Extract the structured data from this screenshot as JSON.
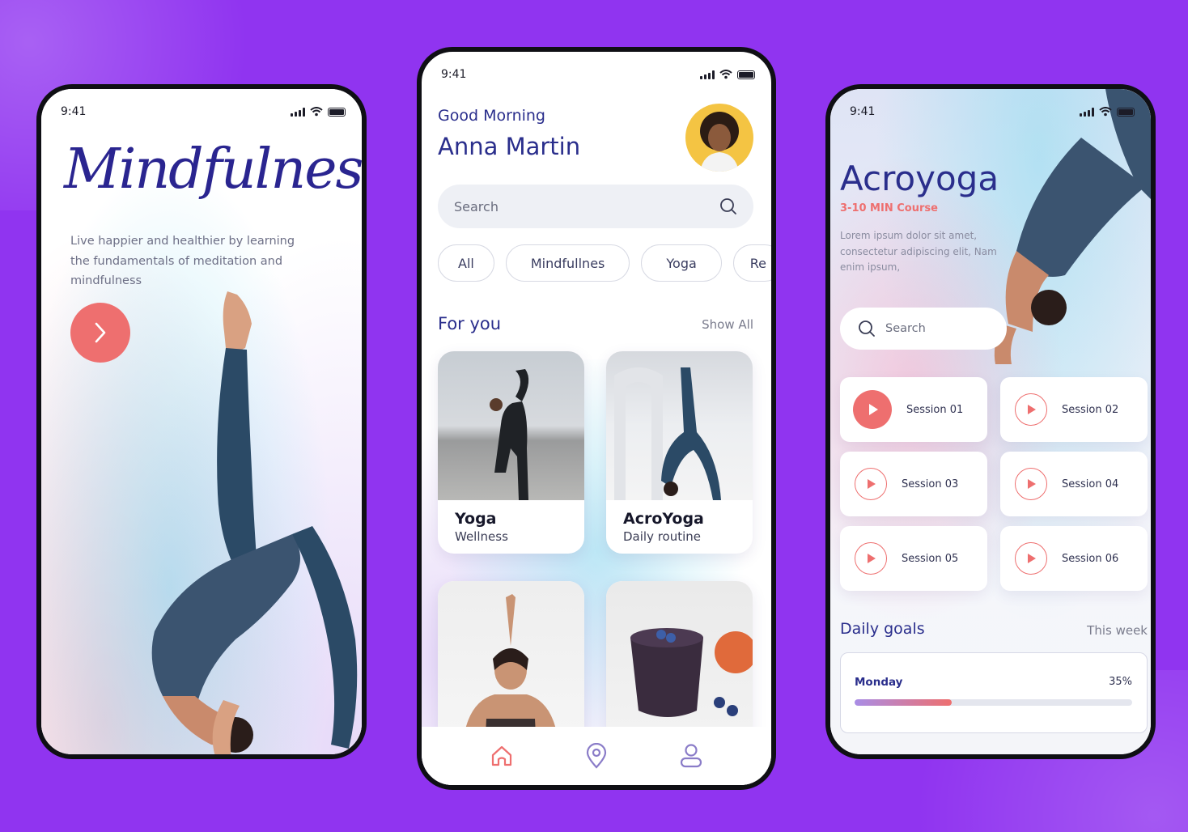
{
  "colors": {
    "background": "#9034f0",
    "accent": "#ee6f6f",
    "primary_text": "#2a2e8c"
  },
  "phone1": {
    "time": "9:41",
    "title": "Mindfulness",
    "description": "Live happier and healthier by learning the fundamentals of meditation and mindfulness",
    "next_icon": "chevron-right-icon"
  },
  "phone2": {
    "time": "9:41",
    "greeting": "Good Morning",
    "name": "Anna Martin",
    "search": {
      "placeholder": "Search",
      "icon": "search-icon"
    },
    "chips": [
      "All",
      "Mindfullnes",
      "Yoga",
      "Re"
    ],
    "section_title": "For you",
    "show_all": "Show All",
    "cards": [
      {
        "title": "Yoga",
        "subtitle": "Wellness"
      },
      {
        "title": "AcroYoga",
        "subtitle": "Daily routine"
      }
    ],
    "nav": [
      "home-icon",
      "location-pin-icon",
      "profile-icon"
    ]
  },
  "phone3": {
    "time": "9:41",
    "title": "Acroyoga",
    "subtitle": "3-10 MIN Course",
    "description": "Lorem ipsum dolor sit amet, consectetur adipiscing elit, Nam enim ipsum,",
    "search": {
      "placeholder": "Search"
    },
    "sessions": [
      "Session 01",
      "Session 02",
      "Session 03",
      "Session 04",
      "Session 05",
      "Session 06"
    ],
    "goals_title": "Daily goals",
    "goals_period": "This week",
    "goal": {
      "day": "Monday",
      "percent_label": "35%",
      "progress": 0.35
    }
  }
}
